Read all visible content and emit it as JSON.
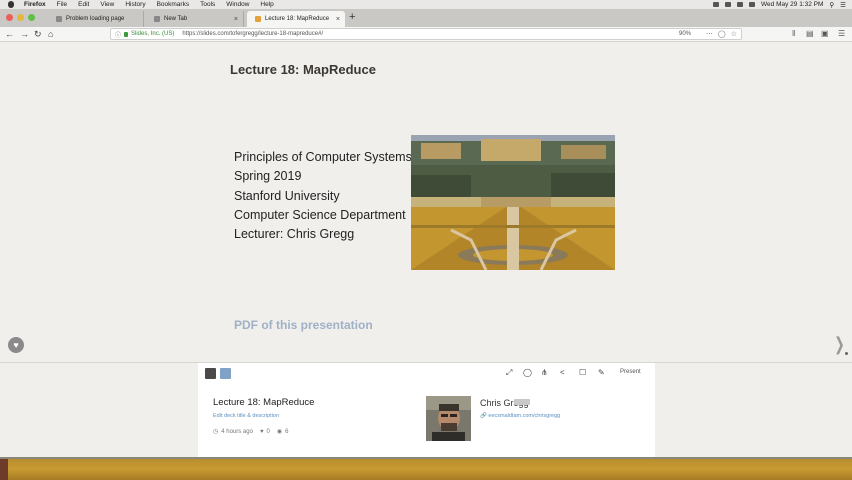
{
  "menubar": {
    "app": "Firefox",
    "items": [
      "File",
      "Edit",
      "View",
      "History",
      "Bookmarks",
      "Tools",
      "Window",
      "Help"
    ],
    "clock": "Wed May 29  1:32 PM"
  },
  "tabs": [
    {
      "label": "Problem loading page",
      "active": false
    },
    {
      "label": "New Tab",
      "active": false
    },
    {
      "label": "Lecture 18: MapReduce",
      "active": true
    }
  ],
  "navbar": {
    "org": "Slides, Inc. (US)",
    "url": "https://slides.com/tofergregg/lecture-18-mapreduce#/",
    "zoom": "90%"
  },
  "slide": {
    "title": "Lecture 18: MapReduce",
    "lines": [
      "Principles of Computer Systems",
      "Spring 2019",
      "Stanford University",
      "Computer Science Department",
      "Lecturer: Chris Gregg"
    ],
    "pdf_link": "PDF of this presentation"
  },
  "deck": {
    "present_label": "Present",
    "title": "Lecture 18: MapReduce",
    "edit_link": "Edit deck title & description",
    "age": "4 hours ago",
    "likes": "0",
    "views": "6",
    "author_name": "Chris Gregg",
    "author_badge": "PRO",
    "author_link": "eecsmaldtam.com/chrisgregg"
  },
  "colors": {
    "title": "#3b3733",
    "link_blue": "#5d8fc2",
    "pdf_link": "#9fb0c7",
    "background": "#f0efeb"
  }
}
